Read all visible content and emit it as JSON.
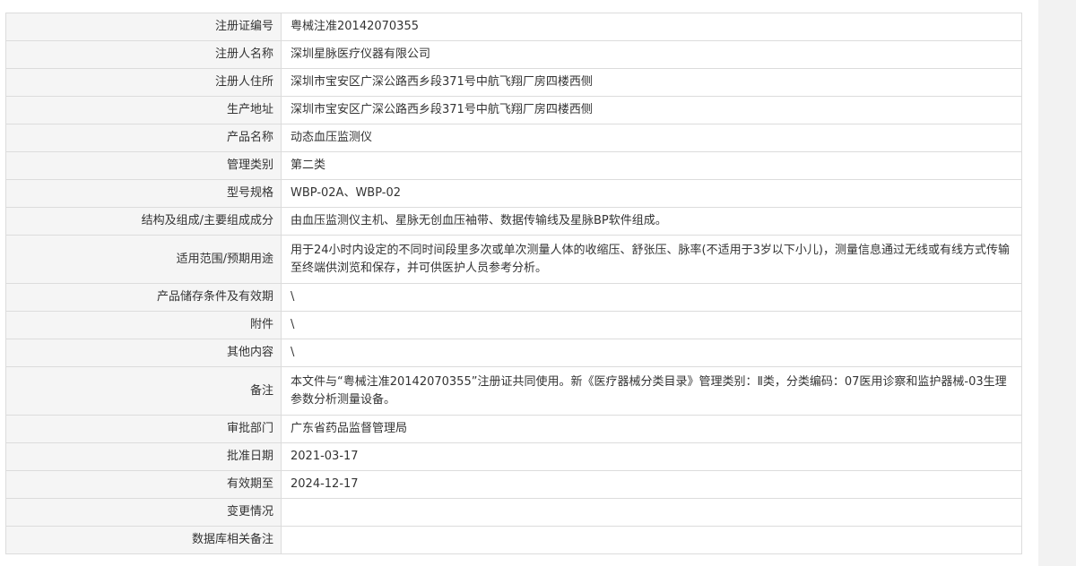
{
  "registration": {
    "rows": [
      {
        "label": "注册证编号",
        "value": "粤械注准20142070355"
      },
      {
        "label": "注册人名称",
        "value": "深圳星脉医疗仪器有限公司"
      },
      {
        "label": "注册人住所",
        "value": "深圳市宝安区广深公路西乡段371号中航飞翔厂房四楼西侧"
      },
      {
        "label": "生产地址",
        "value": "深圳市宝安区广深公路西乡段371号中航飞翔厂房四楼西侧"
      },
      {
        "label": "产品名称",
        "value": "动态血压监测仪"
      },
      {
        "label": "管理类别",
        "value": "第二类"
      },
      {
        "label": "型号规格",
        "value": "WBP-02A、WBP-02"
      },
      {
        "label": "结构及组成/主要组成成分",
        "value": "由血压监测仪主机、星脉无创血压袖带、数据传输线及星脉BP软件组成。"
      },
      {
        "label": "适用范围/预期用途",
        "value": "用于24小时内设定的不同时间段里多次或单次测量人体的收缩压、舒张压、脉率(不适用于3岁以下小儿)，测量信息通过无线或有线方式传输至终端供浏览和保存，并可供医护人员参考分析。"
      },
      {
        "label": "产品储存条件及有效期",
        "value": "\\"
      },
      {
        "label": "附件",
        "value": "\\"
      },
      {
        "label": "其他内容",
        "value": "\\"
      },
      {
        "label": "备注",
        "value": "本文件与“粤械注准20142070355”注册证共同使用。新《医疗器械分类目录》管理类别：Ⅱ类，分类编码：07医用诊察和监护器械-03生理参数分析测量设备。"
      },
      {
        "label": "审批部门",
        "value": "广东省药品监督管理局"
      },
      {
        "label": "批准日期",
        "value": "2021-03-17"
      },
      {
        "label": "有效期至",
        "value": "2024-12-17"
      },
      {
        "label": "变更情况",
        "value": ""
      },
      {
        "label": "数据库相关备注",
        "value": ""
      }
    ]
  }
}
